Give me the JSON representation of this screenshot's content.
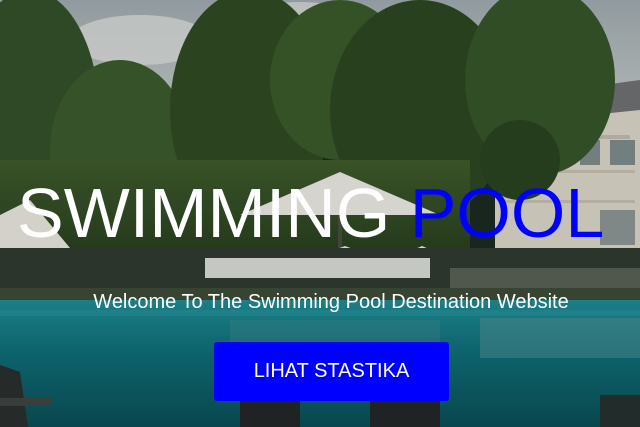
{
  "hero": {
    "title_part1": "SWIMMING",
    "title_part2": "POOL",
    "subtitle": "Welcome To The Swimming Pool Destination Website",
    "cta_label": "LIHAT STASTIKA"
  },
  "colors": {
    "accent": "#0000ff",
    "title_white": "#ffffff",
    "pool_water": "#0f6b73"
  }
}
